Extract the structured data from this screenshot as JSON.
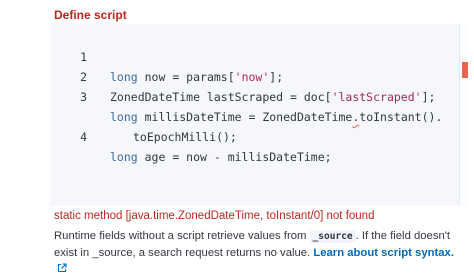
{
  "section": {
    "title": "Define script"
  },
  "editor": {
    "lines": [
      {
        "num": "1",
        "keyword": "long",
        "segments": [
          " now = params[",
          "'now'",
          "];"
        ]
      },
      {
        "num": "2",
        "text_a": "ZonedDateTime lastScraped = doc[",
        "string": "'lastScraped'",
        "text_b": "];"
      },
      {
        "num": "3",
        "keyword": "long",
        "text_a": " millisDateTime = ZonedDateTime",
        "error_token": ".",
        "text_b": "toInstant()."
      },
      {
        "num": "",
        "text": "toEpochMilli();"
      },
      {
        "num": "4",
        "keyword": "long",
        "text": " age = now - millisDateTime;"
      }
    ]
  },
  "error": {
    "message": "static method [java.time.ZonedDateTime, toInstant/0] not found"
  },
  "help": {
    "prefix": "Runtime fields without a script retrieve values from ",
    "code": "_source",
    "suffix": ". If the field doesn't exist in _source, a search request returns no value. ",
    "link": "Learn about script syntax.",
    "link_icon": "external-link-icon"
  },
  "colors": {
    "error": "#bd271e",
    "keyword": "#3f6b9c",
    "string": "#aa2a52",
    "link": "#006bb8",
    "editor_bg": "#f5f7fa",
    "scroll_marker": "#e7664c"
  }
}
